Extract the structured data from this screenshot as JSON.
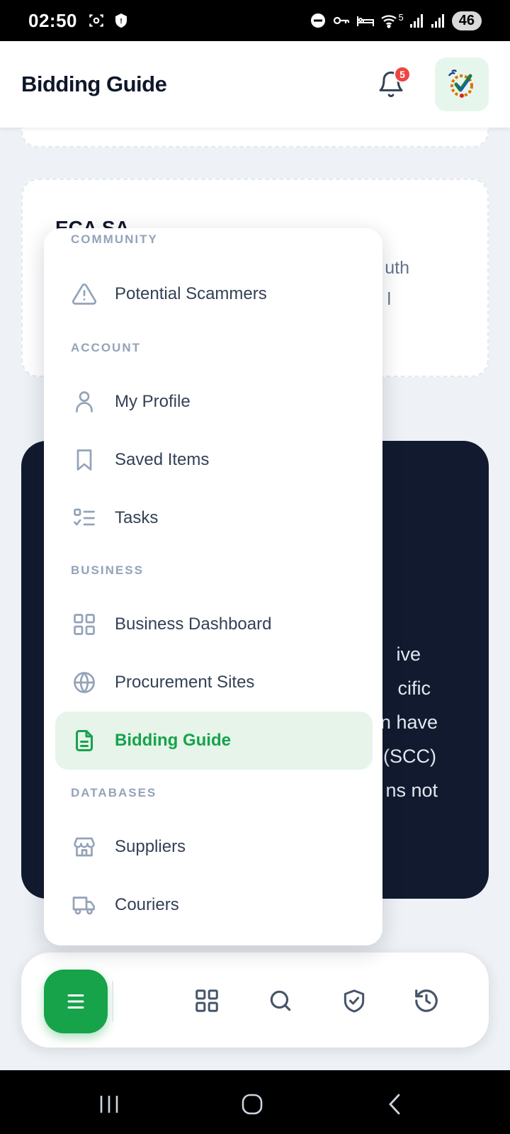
{
  "status_bar": {
    "time": "02:50",
    "battery": "46",
    "signal_label": "5"
  },
  "header": {
    "title": "Bidding Guide",
    "notification_count": "5"
  },
  "background": {
    "card_title": "ECA SA",
    "card_text_1": "uth",
    "card_text_2": "l",
    "dark_lines": [
      "ive",
      "cific",
      "n have",
      "(SCC)",
      "ns not"
    ]
  },
  "menu": {
    "sections": {
      "community": "COMMUNITY",
      "account": "ACCOUNT",
      "business": "BUSINESS",
      "databases": "DATABASES"
    },
    "items": {
      "potential_scammers": "Potential Scammers",
      "my_profile": "My Profile",
      "saved_items": "Saved Items",
      "tasks": "Tasks",
      "business_dashboard": "Business Dashboard",
      "procurement_sites": "Procurement Sites",
      "bidding_guide": "Bidding Guide",
      "suppliers": "Suppliers",
      "couriers": "Couriers"
    },
    "active_item": "bidding_guide"
  },
  "colors": {
    "accent": "#16a34a",
    "active_bg": "#e6f4ea",
    "dark_card": "#111a2e",
    "badge": "#ef4444"
  }
}
